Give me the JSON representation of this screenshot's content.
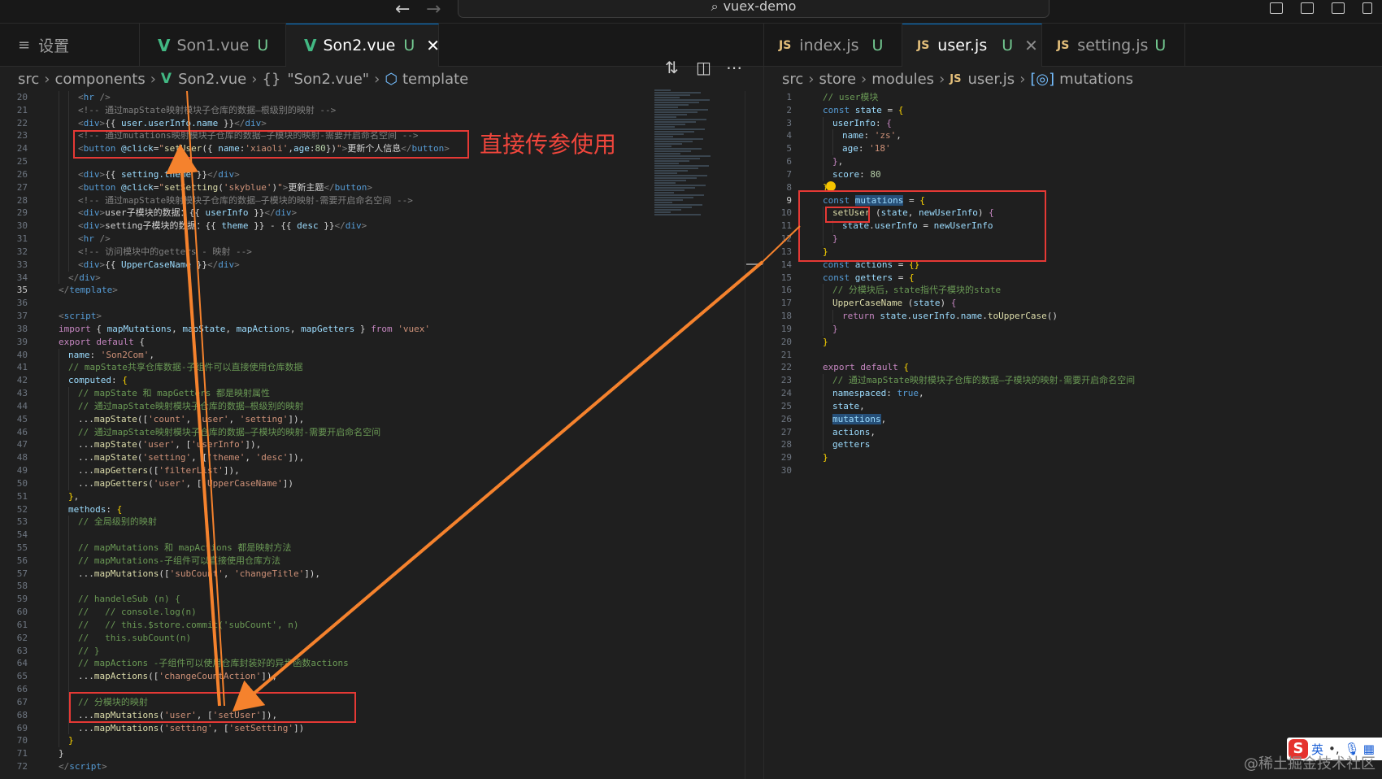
{
  "window": {
    "search_text": "vuex-demo"
  },
  "left_tabs": [
    {
      "label": "设置"
    },
    {
      "label": "Son1.vue",
      "badge": "U"
    },
    {
      "label": "Son2.vue",
      "badge": "U"
    }
  ],
  "right_tabs": [
    {
      "label": "index.js",
      "badge": "U"
    },
    {
      "label": "user.js",
      "badge": "U"
    },
    {
      "label": "setting.js",
      "badge": "U"
    }
  ],
  "left_breadcrumb": [
    "src",
    "components",
    "Son2.vue",
    "\"Son2.vue\"",
    "template"
  ],
  "right_breadcrumb": [
    "src",
    "store",
    "modules",
    "user.js",
    "mutations"
  ],
  "left_code": [
    {
      "n": "20",
      "html": "<span class='t'>&lt;</span><span class='k'>hr</span> <span class='t'>/&gt;</span>",
      "i": 3
    },
    {
      "n": "21",
      "html": "<span class='t'>&lt;!-- 通过mapState映射模块子仓库的数据—根级别的映射 --&gt;</span>",
      "i": 3
    },
    {
      "n": "22",
      "html": "<span class='t'>&lt;</span><span class='k'>div</span><span class='t'>&gt;</span><span class='w'>{{ </span><span class='v'>user.userInfo.name</span><span class='w'> }}</span><span class='t'>&lt;/</span><span class='k'>div</span><span class='t'>&gt;</span>",
      "i": 3
    },
    {
      "n": "23",
      "html": "<span class='t'>&lt;!-- 通过mutations映射模块子仓库的数据—子模块的映射-需要开启命名空间 --&gt;</span>",
      "i": 3
    },
    {
      "n": "24",
      "html": "<span class='t'>&lt;</span><span class='k'>button</span> <span class='v'>@click</span><span class='w'>=</span><span class='s'>\"</span><span class='f'>setUser</span><span class='w'>({ </span><span class='v'>name</span><span class='w'>:</span><span class='s'>'xiaoli'</span><span class='w'>,</span><span class='v'>age</span><span class='w'>:</span><span class='n'>80</span><span class='w'>})</span><span class='s'>\"</span><span class='t'>&gt;</span><span class='w'>更新个人信息</span><span class='t'>&lt;/</span><span class='k'>button</span><span class='t'>&gt;</span>",
      "i": 3
    },
    {
      "n": "25",
      "html": "",
      "i": 3
    },
    {
      "n": "26",
      "html": "<span class='t'>&lt;</span><span class='k'>div</span><span class='t'>&gt;</span><span class='w'>{{ </span><span class='v'>setting.theme</span><span class='w'> }}</span><span class='t'>&lt;/</span><span class='k'>div</span><span class='t'>&gt;</span>",
      "i": 3
    },
    {
      "n": "27",
      "html": "<span class='t'>&lt;</span><span class='k'>button</span> <span class='v'>@click</span><span class='w'>=</span><span class='s'>\"</span><span class='f'>setSetting</span><span class='w'>(</span><span class='s'>'skyblue'</span><span class='w'>)</span><span class='s'>\"</span><span class='t'>&gt;</span><span class='w'>更新主题</span><span class='t'>&lt;/</span><span class='k'>button</span><span class='t'>&gt;</span>",
      "i": 3
    },
    {
      "n": "28",
      "html": "<span class='t'>&lt;!-- 通过mapState映射模块子仓库的数据—子模块的映射-需要开启命名空间 --&gt;</span>",
      "i": 3
    },
    {
      "n": "29",
      "html": "<span class='t'>&lt;</span><span class='k'>div</span><span class='t'>&gt;</span><span class='w'>user子模块的数据：{{ </span><span class='v'>userInfo</span><span class='w'> }}</span><span class='t'>&lt;/</span><span class='k'>div</span><span class='t'>&gt;</span>",
      "i": 3
    },
    {
      "n": "30",
      "html": "<span class='t'>&lt;</span><span class='k'>div</span><span class='t'>&gt;</span><span class='w'>setting子模块的数据：{{ </span><span class='v'>theme</span><span class='w'> }} - {{ </span><span class='v'>desc</span><span class='w'> }}</span><span class='t'>&lt;/</span><span class='k'>div</span><span class='t'>&gt;</span>",
      "i": 3
    },
    {
      "n": "31",
      "html": "<span class='t'>&lt;</span><span class='k'>hr</span> <span class='t'>/&gt;</span>",
      "i": 3
    },
    {
      "n": "32",
      "html": "<span class='t'>&lt;!-- 访问模块中的getters - 映射 --&gt;</span>",
      "i": 3
    },
    {
      "n": "33",
      "html": "<span class='t'>&lt;</span><span class='k'>div</span><span class='t'>&gt;</span><span class='w'>{{ </span><span class='v'>UpperCaseName</span><span class='w'> }}</span><span class='t'>&lt;/</span><span class='k'>div</span><span class='t'>&gt;</span>",
      "i": 3
    },
    {
      "n": "34",
      "html": "<span class='t'>&lt;/</span><span class='k'>div</span><span class='t'>&gt;</span>",
      "i": 2
    },
    {
      "n": "35",
      "html": "<span class='t'>&lt;/</span><span class='k'>template</span><span class='t'>&gt;</span>",
      "i": 1,
      "cur": true
    },
    {
      "n": "36",
      "html": "",
      "i": 1
    },
    {
      "n": "37",
      "html": "<span class='t'>&lt;</span><span class='k'>script</span><span class='t'>&gt;</span>",
      "i": 1
    },
    {
      "n": "38",
      "html": "<span class='p'>import</span><span class='w'> { </span><span class='v'>mapMutations</span><span class='w'>, </span><span class='v'>mapState</span><span class='w'>, </span><span class='v'>mapActions</span><span class='w'>, </span><span class='v'>mapGetters</span><span class='w'> } </span><span class='p'>from</span> <span class='s'>'vuex'</span>",
      "i": 1
    },
    {
      "n": "39",
      "html": "<span class='p'>export</span> <span class='p'>default</span><span class='w'> {</span>",
      "i": 1
    },
    {
      "n": "40",
      "html": "<span class='v'>name</span><span class='w'>: </span><span class='s'>'Son2Com'</span><span class='w'>,</span>",
      "i": 2
    },
    {
      "n": "41",
      "html": "<span class='c'>// mapState共享仓库数据-子组件可以直接使用仓库数据</span>",
      "i": 2
    },
    {
      "n": "42",
      "html": "<span class='v'>computed</span><span class='w'>: </span><span class='y'>{</span>",
      "i": 2
    },
    {
      "n": "43",
      "html": "<span class='c'>// mapState 和 mapGetters 都是映射属性</span>",
      "i": 3
    },
    {
      "n": "44",
      "html": "<span class='c'>// 通过mapState映射模块子仓库的数据—根级别的映射</span>",
      "i": 3
    },
    {
      "n": "45",
      "html": "<span class='w'>...</span><span class='f'>mapState</span><span class='w'>([</span><span class='s'>'count'</span><span class='w'>, </span><span class='s'>'user'</span><span class='w'>, </span><span class='s'>'setting'</span><span class='w'>]),</span>",
      "i": 3
    },
    {
      "n": "46",
      "html": "<span class='c'>// 通过mapState映射模块子仓库的数据—子模块的映射-需要开启命名空间</span>",
      "i": 3
    },
    {
      "n": "47",
      "html": "<span class='w'>...</span><span class='f'>mapState</span><span class='w'>(</span><span class='s'>'user'</span><span class='w'>, [</span><span class='s'>'userInfo'</span><span class='w'>]),</span>",
      "i": 3
    },
    {
      "n": "48",
      "html": "<span class='w'>...</span><span class='f'>mapState</span><span class='w'>(</span><span class='s'>'setting'</span><span class='w'>, [</span><span class='s'>'theme'</span><span class='w'>, </span><span class='s'>'desc'</span><span class='w'>]),</span>",
      "i": 3
    },
    {
      "n": "49",
      "html": "<span class='w'>...</span><span class='f'>mapGetters</span><span class='w'>([</span><span class='s'>'filterList'</span><span class='w'>]),</span>",
      "i": 3
    },
    {
      "n": "50",
      "html": "<span class='w'>...</span><span class='f'>mapGetters</span><span class='w'>(</span><span class='s'>'user'</span><span class='w'>, [</span><span class='s'>'UpperCaseName'</span><span class='w'>])</span>",
      "i": 3
    },
    {
      "n": "51",
      "html": "<span class='y'>}</span><span class='w'>,</span>",
      "i": 2
    },
    {
      "n": "52",
      "html": "<span class='v'>methods</span><span class='w'>: </span><span class='y'>{</span>",
      "i": 2
    },
    {
      "n": "53",
      "html": "<span class='c'>// 全局级别的映射</span>",
      "i": 3
    },
    {
      "n": "54",
      "html": "",
      "i": 3
    },
    {
      "n": "55",
      "html": "<span class='c'>// mapMutations 和 mapActions 都是映射方法</span>",
      "i": 3
    },
    {
      "n": "56",
      "html": "<span class='c'>// mapMutations-子组件可以直接使用仓库方法</span>",
      "i": 3
    },
    {
      "n": "57",
      "html": "<span class='w'>...</span><span class='f'>mapMutations</span><span class='w'>([</span><span class='s'>'subCount'</span><span class='w'>, </span><span class='s'>'changeTitle'</span><span class='w'>]),</span>",
      "i": 3
    },
    {
      "n": "58",
      "html": "",
      "i": 3
    },
    {
      "n": "59",
      "html": "<span class='c'>// handeleSub (n) {</span>",
      "i": 3
    },
    {
      "n": "60",
      "html": "<span class='c'>//   // console.log(n)</span>",
      "i": 3
    },
    {
      "n": "61",
      "html": "<span class='c'>//   // this.$store.commit('subCount', n)</span>",
      "i": 3
    },
    {
      "n": "62",
      "html": "<span class='c'>//   this.subCount(n)</span>",
      "i": 3
    },
    {
      "n": "63",
      "html": "<span class='c'>// }</span>",
      "i": 3
    },
    {
      "n": "64",
      "html": "<span class='c'>// mapActions -子组件可以使用仓库封装好的异步函数actions</span>",
      "i": 3
    },
    {
      "n": "65",
      "html": "<span class='w'>...</span><span class='f'>mapActions</span><span class='w'>([</span><span class='s'>'changeCountAction'</span><span class='w'>]),</span>",
      "i": 3
    },
    {
      "n": "66",
      "html": "",
      "i": 3
    },
    {
      "n": "67",
      "html": "<span class='c'>// 分模块的映射</span>",
      "i": 3
    },
    {
      "n": "68",
      "html": "<span class='w'>...</span><span class='f'>mapMutations</span><span class='w'>(</span><span class='s'>'user'</span><span class='w'>, [</span><span class='s'>'setUser'</span><span class='w'>]),</span>",
      "i": 3
    },
    {
      "n": "69",
      "html": "<span class='w'>...</span><span class='f'>mapMutations</span><span class='w'>(</span><span class='s'>'setting'</span><span class='w'>, [</span><span class='s'>'setSetting'</span><span class='w'>])</span>",
      "i": 3
    },
    {
      "n": "70",
      "html": "<span class='y'>}</span>",
      "i": 2
    },
    {
      "n": "71",
      "html": "<span class='w'>}</span>",
      "i": 1
    },
    {
      "n": "72",
      "html": "<span class='t'>&lt;/</span><span class='k'>script</span><span class='t'>&gt;</span>",
      "i": 1
    }
  ],
  "right_code": [
    {
      "n": "1",
      "html": "<span class='c'>// user模块</span>",
      "i": 1
    },
    {
      "n": "2",
      "html": "<span class='k'>const</span> <span class='v'>state</span><span class='w'> = </span><span class='y'>{</span>",
      "i": 1
    },
    {
      "n": "3",
      "html": "<span class='v'>userInfo</span><span class='w'>: </span><span class='p'>{</span>",
      "i": 2
    },
    {
      "n": "4",
      "html": "<span class='v'>name</span><span class='w'>: </span><span class='s'>'zs'</span><span class='w'>,</span>",
      "i": 3
    },
    {
      "n": "5",
      "html": "<span class='v'>age</span><span class='w'>: </span><span class='s'>'18'</span>",
      "i": 3
    },
    {
      "n": "6",
      "html": "<span class='p'>}</span><span class='w'>,</span>",
      "i": 2
    },
    {
      "n": "7",
      "html": "<span class='v'>score</span><span class='w'>: </span><span class='n'>80</span>",
      "i": 2
    },
    {
      "n": "8",
      "html": "<span class='y'>}</span>",
      "i": 1
    },
    {
      "n": "9",
      "html": "<span class='k'>const</span> <span class='v hl'>mutations</span><span class='w'> = </span><span class='y'>{</span>",
      "i": 1,
      "cur": true
    },
    {
      "n": "10",
      "html": "<span class='f'>setUser</span><span class='w'> (</span><span class='v'>state</span><span class='w'>, </span><span class='v'>newUserInfo</span><span class='w'>) </span><span class='p'>{</span>",
      "i": 2
    },
    {
      "n": "11",
      "html": "<span class='v'>state</span><span class='w'>.</span><span class='v'>userInfo</span><span class='w'> = </span><span class='v'>newUserInfo</span>",
      "i": 3
    },
    {
      "n": "12",
      "html": "<span class='p'>}</span>",
      "i": 2
    },
    {
      "n": "13",
      "html": "<span class='y'>}</span>",
      "i": 1
    },
    {
      "n": "14",
      "html": "<span class='k'>const</span> <span class='v'>actions</span><span class='w'> = </span><span class='y'>{}</span>",
      "i": 1
    },
    {
      "n": "15",
      "html": "<span class='k'>const</span> <span class='v'>getters</span><span class='w'> = </span><span class='y'>{</span>",
      "i": 1
    },
    {
      "n": "16",
      "html": "<span class='c'>// 分模块后，state指代子模块的state</span>",
      "i": 2
    },
    {
      "n": "17",
      "html": "<span class='f'>UpperCaseName</span><span class='w'> (</span><span class='v'>state</span><span class='w'>) </span><span class='p'>{</span>",
      "i": 2
    },
    {
      "n": "18",
      "html": "<span class='p'>return</span> <span class='v'>state</span><span class='w'>.</span><span class='v'>userInfo</span><span class='w'>.</span><span class='v'>name</span><span class='w'>.</span><span class='f'>toUpperCase</span><span class='w'>()</span>",
      "i": 3
    },
    {
      "n": "19",
      "html": "<span class='p'>}</span>",
      "i": 2
    },
    {
      "n": "20",
      "html": "<span class='y'>}</span>",
      "i": 1
    },
    {
      "n": "21",
      "html": "",
      "i": 1
    },
    {
      "n": "22",
      "html": "<span class='p'>export</span> <span class='p'>default</span><span class='w'> </span><span class='y'>{</span>",
      "i": 1
    },
    {
      "n": "23",
      "html": "<span class='c'>// 通过mapState映射模块子仓库的数据—子模块的映射-需要开启命名空间</span>",
      "i": 2
    },
    {
      "n": "24",
      "html": "<span class='v'>namespaced</span><span class='w'>: </span><span class='k'>true</span><span class='w'>,</span>",
      "i": 2
    },
    {
      "n": "25",
      "html": "<span class='v'>state</span><span class='w'>,</span>",
      "i": 2
    },
    {
      "n": "26",
      "html": "<span class='v hl'>mutations</span><span class='w'>,</span>",
      "i": 2
    },
    {
      "n": "27",
      "html": "<span class='v'>actions</span><span class='w'>,</span>",
      "i": 2
    },
    {
      "n": "28",
      "html": "<span class='v'>getters</span>",
      "i": 2
    },
    {
      "n": "29",
      "html": "<span class='y'>}</span>",
      "i": 1
    },
    {
      "n": "30",
      "html": "",
      "i": 1
    }
  ],
  "annotation": {
    "label": "直接传参使用",
    "color": "#f0463c",
    "arrow_color": "#f5822d"
  },
  "ime": {
    "text": "英"
  },
  "watermark": "@稀土掘金技术社区"
}
